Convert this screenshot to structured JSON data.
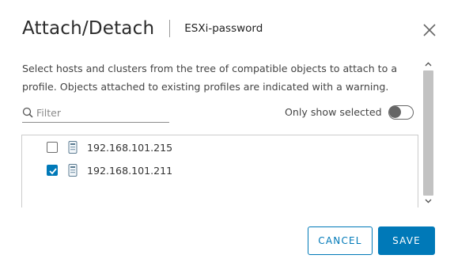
{
  "dialog": {
    "title": "Attach/Detach",
    "subtitle": "ESXi-password",
    "close_icon": "close-icon"
  },
  "content": {
    "description": "Select hosts and clusters from the tree of compatible objects to attach to a profile. Objects attached to existing profiles are indicated with a warning.",
    "filter": {
      "placeholder": "Filter",
      "value": "",
      "icon": "search-icon"
    },
    "only_show_selected": {
      "label": "Only show selected",
      "enabled": false
    },
    "tree": {
      "items": [
        {
          "label": "192.168.101.215",
          "checked": false,
          "icon": "host-icon"
        },
        {
          "label": "192.168.101.211",
          "checked": true,
          "icon": "host-icon"
        }
      ]
    }
  },
  "footer": {
    "cancel_label": "CANCEL",
    "save_label": "SAVE"
  },
  "colors": {
    "accent": "#0079b8",
    "toggle_off": "#666666",
    "scrollbar_thumb": "#c2c2c2"
  }
}
